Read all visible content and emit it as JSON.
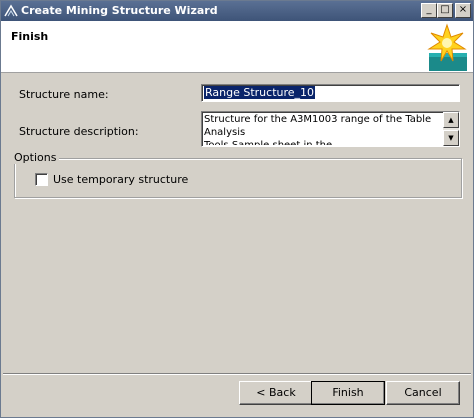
{
  "window": {
    "title": "Create Mining Structure Wizard",
    "minimize_glyph": "_",
    "maximize_glyph": "□",
    "close_glyph": "×"
  },
  "header": {
    "title": "Finish"
  },
  "form": {
    "structure_name_label": "Structure name:",
    "structure_name_value": "Range Structure_10",
    "structure_description_label": "Structure description:",
    "structure_description_value": "Structure for the A3M1003 range of the Table Analysis\nTools Sample sheet in the DMAddins_SampleDataxlsx"
  },
  "options": {
    "group_label": "Options",
    "use_temporary_label": "Use temporary structure",
    "use_temporary_checked": false
  },
  "buttons": {
    "back": "< Back",
    "finish": "Finish",
    "cancel": "Cancel"
  },
  "icons": {
    "title_icon": "wizard-icon",
    "header_graphic": "finish-burst-icon",
    "scroll_up": "scroll-up-arrow-icon",
    "scroll_down": "scroll-down-arrow-icon"
  },
  "colors": {
    "titlebar": "#3e5478",
    "dialog_bg": "#d4d0c8",
    "selection": "#0a246a"
  }
}
